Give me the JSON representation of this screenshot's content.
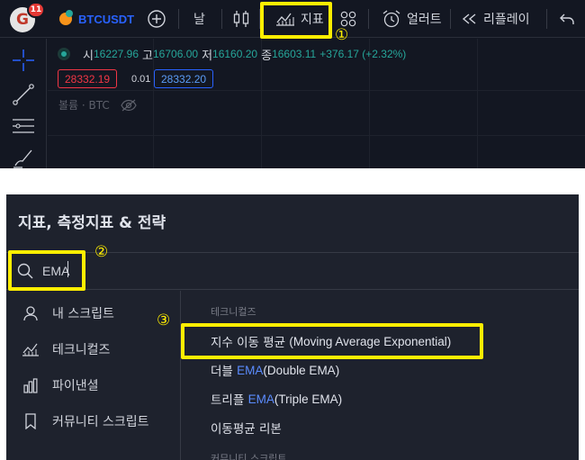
{
  "toolbar": {
    "avatar_letter": "G",
    "notification_count": "11",
    "symbol": "BTCUSDT",
    "add_symbol_icon": "plus-circle-icon",
    "interval": "날",
    "chart_type_icon": "candles-icon",
    "indicators_label": "지표",
    "indicators_icon": "indicators-icon",
    "layout_icon": "grid-icon",
    "alert_label": "얼러트",
    "alert_icon": "alarm-clock-icon",
    "replay_label": "리플레이",
    "replay_icon": "rewind-icon",
    "undo_icon": "undo-icon"
  },
  "annotations": {
    "step1": "①",
    "step2": "②",
    "step3": "③",
    "highlight_color": "#ffee00"
  },
  "drawing_tools": [
    "crosshair-icon",
    "trend-line-icon",
    "horizontal-lines-icon",
    "brush-icon"
  ],
  "legend": {
    "open_label": "시",
    "open": "16227.96",
    "high_label": "고",
    "high": "16706.00",
    "low_label": "저",
    "low": "16160.20",
    "close_label": "종",
    "close": "16603.11",
    "change": "+376.17 (+2.32%)",
    "up_color": "#26a69a"
  },
  "order": {
    "sell_price": "28332.19",
    "spread": "0.01",
    "buy_price": "28332.20"
  },
  "volume": {
    "label": "볼륨 · BTC",
    "visibility_icon": "eye-off-icon"
  },
  "dialog": {
    "title": "지표, 측정지표 & 전략",
    "search_value": "EMA",
    "search_icon": "search-icon",
    "sidebar": [
      {
        "label": "내 스크립트",
        "icon": "user-icon"
      },
      {
        "label": "테크니컬즈",
        "icon": "chart-icon"
      },
      {
        "label": "파이낸셜",
        "icon": "bar-chart-icon"
      },
      {
        "label": "커뮤니티 스크립트",
        "icon": "bookmark-icon"
      }
    ],
    "section_label": "테크니컬즈",
    "results": [
      {
        "prefix": "지수 이동 평균 ",
        "en": "(Moving Average Exponential)"
      },
      {
        "prefix": "더블 ",
        "hl": "EMA",
        "en": " (Double EMA)"
      },
      {
        "prefix": "트리플 ",
        "hl": "EMA",
        "en": " (Triple EMA)"
      },
      {
        "prefix": "이동평균 리본"
      }
    ],
    "next_section_label": "커뮤니티 스크립트"
  }
}
